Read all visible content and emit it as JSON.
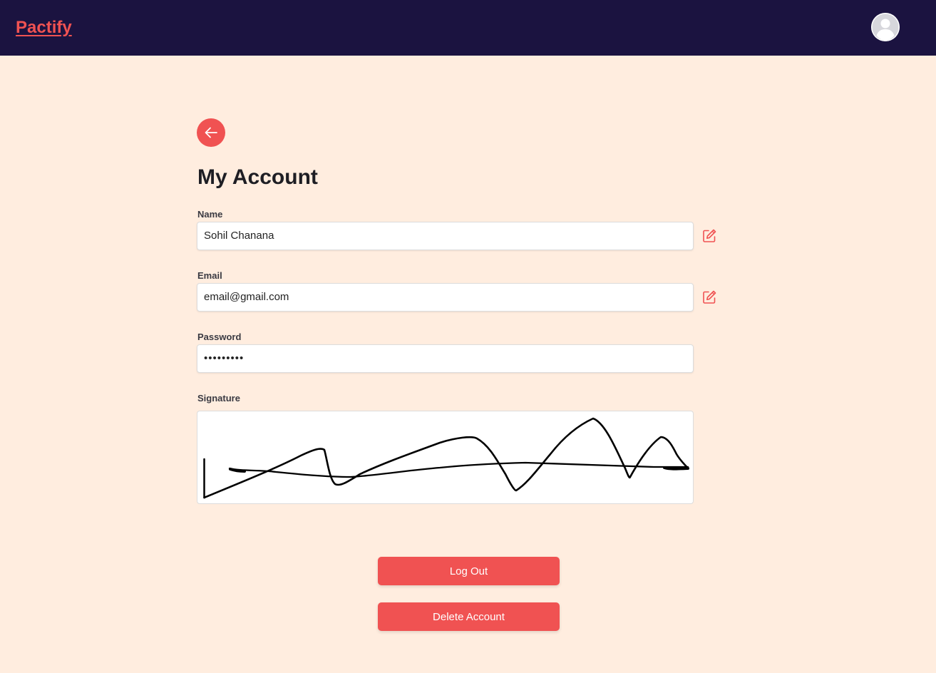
{
  "header": {
    "brand": "Pactify",
    "profile_icon": "user-avatar-icon"
  },
  "page": {
    "back_icon": "arrow-left-icon",
    "title": "My Account"
  },
  "fields": {
    "name": {
      "label": "Name",
      "value": "Sohil Chanana",
      "edit_icon": "pencil-square-icon"
    },
    "email": {
      "label": "Email",
      "value": "email@gmail.com",
      "edit_icon": "pencil-square-icon"
    },
    "password": {
      "label": "Password",
      "value": "•••••••••"
    },
    "signature": {
      "label": "Signature"
    }
  },
  "actions": {
    "logout": "Log Out",
    "delete": "Delete Account"
  },
  "colors": {
    "navbar": "#1b1340",
    "accent": "#f05252",
    "background": "#ffeddf"
  }
}
